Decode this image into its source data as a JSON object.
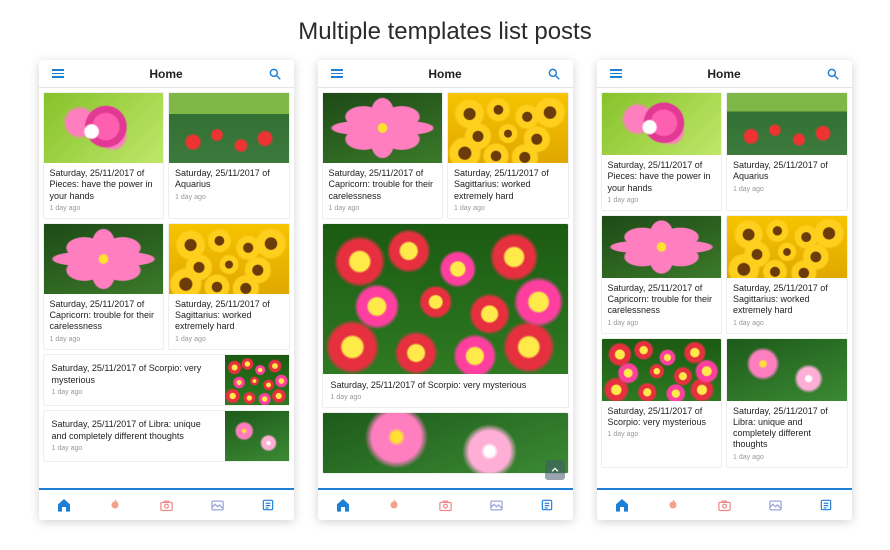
{
  "page_title": "Multiple templates list posts",
  "accent_color": "#1e7fd6",
  "header": {
    "title": "Home"
  },
  "meta_text": "1 day ago",
  "posts": {
    "pieces": {
      "title": "Saturday, 25/11/2017 of Pieces: have the power in your hands"
    },
    "aquarius": {
      "title": "Saturday, 25/11/2017 of Aquarius"
    },
    "capricorn": {
      "title": "Saturday, 25/11/2017 of Capricorn: trouble for their carelessness"
    },
    "sagittarius": {
      "title": "Saturday, 25/11/2017 of Sagittarius: worked extremely hard"
    },
    "scorpio": {
      "title": "Saturday, 25/11/2017 of Scorpio: very mysterious"
    },
    "libra": {
      "title": "Saturday, 25/11/2017 of Libra: unique and completely different thoughts"
    }
  },
  "bottom_tabs": [
    "home",
    "trending",
    "camera",
    "gallery",
    "list"
  ]
}
